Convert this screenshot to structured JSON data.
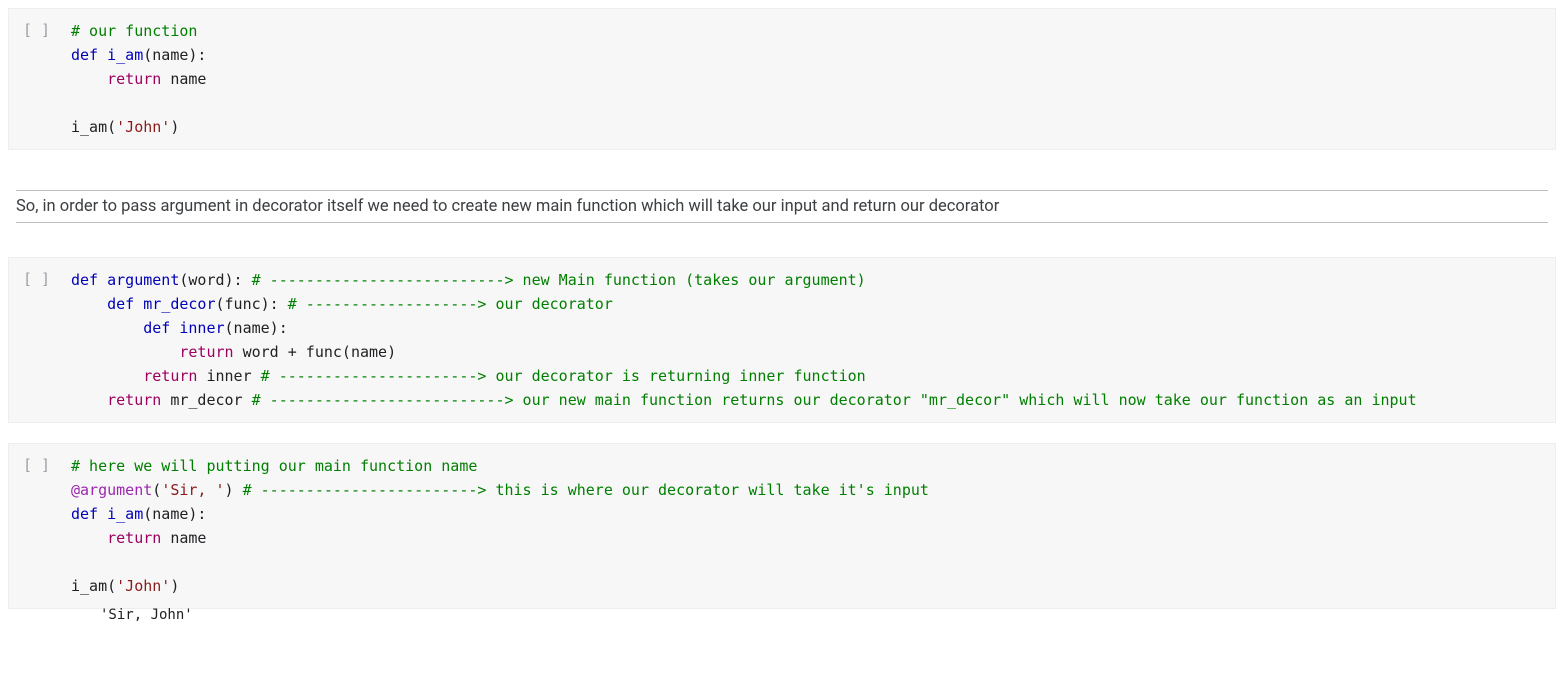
{
  "cells": {
    "c1": {
      "prompt": "[ ]",
      "code": "<span class=\"c\"># our function</span>\n<span class=\"kw\">def</span> <span class=\"fn\">i_am</span>(name):\n    <span class=\"rt\">return</span> name\n\ni_am(<span class=\"str\">'John'</span>)"
    },
    "text": {
      "desc": "So, in order to pass argument in decorator itself we need to create new main function which will take our input and return our decorator"
    },
    "c2": {
      "prompt": "[ ]",
      "code": "<span class=\"kw\">def</span> <span class=\"fn\">argument</span>(word): <span class=\"c\"># --------------------------&gt; new Main function (takes our argument)</span>\n    <span class=\"kw\">def</span> <span class=\"fn\">mr_decor</span>(func): <span class=\"c\"># -------------------&gt; our decorator</span>\n        <span class=\"kw\">def</span> <span class=\"fn\">inner</span>(name):\n            <span class=\"rt\">return</span> word + func(name)\n        <span class=\"rt\">return</span> inner <span class=\"c\"># ----------------------&gt; our decorator is returning inner function</span>\n    <span class=\"rt\">return</span> mr_decor <span class=\"c\"># --------------------------&gt; our new main function returns our decorator \"mr_decor\" which will now take our function as an input</span>"
    },
    "c3": {
      "prompt": "[ ]",
      "code": "<span class=\"c\"># here we will putting our main function name</span>\n<span class=\"dec\">@argument</span>(<span class=\"str\">'Sir, '</span>) <span class=\"c\"># ------------------------&gt; this is where our decorator will take it's input</span>\n<span class=\"kw\">def</span> <span class=\"fn\">i_am</span>(name):\n    <span class=\"rt\">return</span> name\n\ni_am(<span class=\"str\">'John'</span>)",
      "output": "'Sir, John'"
    }
  }
}
